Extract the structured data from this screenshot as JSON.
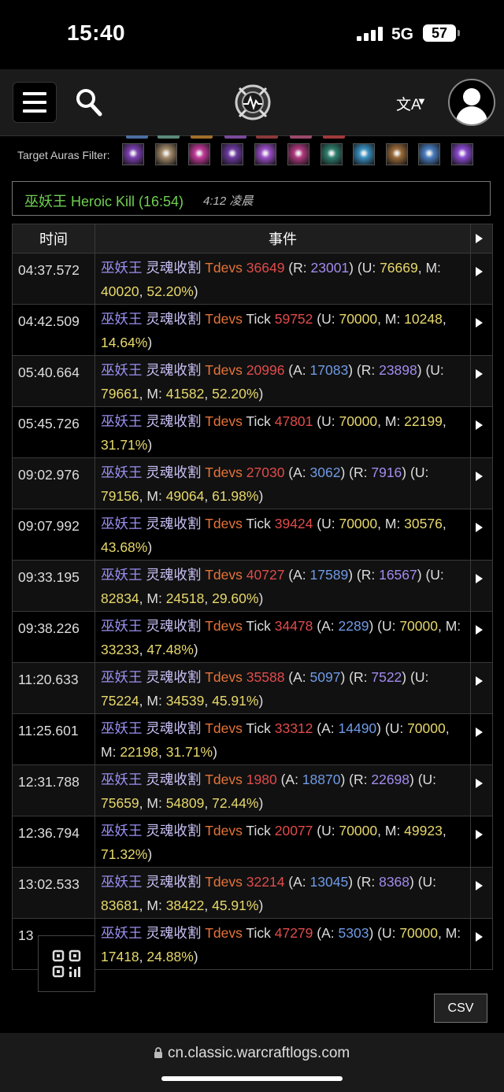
{
  "status_bar": {
    "time": "15:40",
    "network": "5G",
    "battery": "57"
  },
  "header": {
    "menu_icon": "hamburger-icon",
    "search_icon": "search-icon",
    "logo_icon": "warcraftlogs-logo-icon",
    "translate_icon": "translate-icon",
    "avatar_icon": "user-avatar-icon"
  },
  "auras": {
    "label": "Target Auras Filter:",
    "icons": [
      {
        "name": "aura-icon-1",
        "color": "#7b3fb0"
      },
      {
        "name": "aura-icon-2",
        "color": "#a38a6a"
      },
      {
        "name": "aura-icon-3",
        "color": "#c23a9a"
      },
      {
        "name": "aura-icon-4",
        "color": "#6c3aa0"
      },
      {
        "name": "aura-icon-5",
        "color": "#9a4ec7"
      },
      {
        "name": "aura-icon-6",
        "color": "#b03a80"
      },
      {
        "name": "aura-icon-7",
        "color": "#2f7e6e"
      },
      {
        "name": "aura-icon-8",
        "color": "#3a8fc0"
      },
      {
        "name": "aura-icon-9",
        "color": "#9a6a3a"
      },
      {
        "name": "aura-icon-10",
        "color": "#4a7ec0"
      },
      {
        "name": "aura-icon-11",
        "color": "#8a4ad0"
      }
    ]
  },
  "fight": {
    "name": "巫妖王 Heroic Kill (16:54)",
    "time": "4:12 凌晨"
  },
  "table": {
    "headers": {
      "time": "时间",
      "event": "事件"
    },
    "rows": [
      {
        "time": "04:37.572",
        "parts": [
          [
            "巫妖王",
            "src"
          ],
          [
            " 灵魂收割 ",
            "ab"
          ],
          [
            "Tdevs",
            "tgt"
          ],
          [
            " ",
            "g"
          ],
          [
            "36649",
            "dmg"
          ],
          [
            " (R: ",
            "g"
          ],
          [
            "23001",
            "r"
          ],
          [
            ") (U: ",
            "g"
          ],
          [
            "76669",
            "y"
          ],
          [
            ", M: ",
            "g"
          ],
          [
            "40020",
            "y"
          ],
          [
            ", ",
            "g"
          ],
          [
            "52.20%",
            "y"
          ],
          [
            ")",
            "g"
          ]
        ]
      },
      {
        "time": "04:42.509",
        "parts": [
          [
            "巫妖王",
            "src"
          ],
          [
            " 灵魂收割 ",
            "ab"
          ],
          [
            "Tdevs",
            "tgt"
          ],
          [
            " Tick ",
            "g"
          ],
          [
            "59752",
            "dmg"
          ],
          [
            " (U: ",
            "g"
          ],
          [
            "70000",
            "y"
          ],
          [
            ", M: ",
            "g"
          ],
          [
            "10248",
            "y"
          ],
          [
            ", ",
            "g"
          ],
          [
            "14.64%",
            "y"
          ],
          [
            ")",
            "g"
          ]
        ]
      },
      {
        "time": "05:40.664",
        "parts": [
          [
            "巫妖王",
            "src"
          ],
          [
            " 灵魂收割 ",
            "ab"
          ],
          [
            "Tdevs",
            "tgt"
          ],
          [
            " ",
            "g"
          ],
          [
            "20996",
            "dmg"
          ],
          [
            " (A: ",
            "g"
          ],
          [
            "17083",
            "a"
          ],
          [
            ") (R: ",
            "g"
          ],
          [
            "23898",
            "r"
          ],
          [
            ") (U: ",
            "g"
          ],
          [
            "79661",
            "y"
          ],
          [
            ", M: ",
            "g"
          ],
          [
            "41582",
            "y"
          ],
          [
            ", ",
            "g"
          ],
          [
            "52.20%",
            "y"
          ],
          [
            ")",
            "g"
          ]
        ]
      },
      {
        "time": "05:45.726",
        "parts": [
          [
            "巫妖王",
            "src"
          ],
          [
            " 灵魂收割 ",
            "ab"
          ],
          [
            "Tdevs",
            "tgt"
          ],
          [
            " Tick ",
            "g"
          ],
          [
            "47801",
            "dmg"
          ],
          [
            " (U: ",
            "g"
          ],
          [
            "70000",
            "y"
          ],
          [
            ", M: ",
            "g"
          ],
          [
            "22199",
            "y"
          ],
          [
            ", ",
            "g"
          ],
          [
            "31.71%",
            "y"
          ],
          [
            ")",
            "g"
          ]
        ]
      },
      {
        "time": "09:02.976",
        "parts": [
          [
            "巫妖王",
            "src"
          ],
          [
            " 灵魂收割 ",
            "ab"
          ],
          [
            "Tdevs",
            "tgt"
          ],
          [
            " ",
            "g"
          ],
          [
            "27030",
            "dmg"
          ],
          [
            " (A: ",
            "g"
          ],
          [
            "3062",
            "a"
          ],
          [
            ") (R: ",
            "g"
          ],
          [
            "7916",
            "r"
          ],
          [
            ") (U: ",
            "g"
          ],
          [
            "79156",
            "y"
          ],
          [
            ", M: ",
            "g"
          ],
          [
            "49064",
            "y"
          ],
          [
            ", ",
            "g"
          ],
          [
            "61.98%",
            "y"
          ],
          [
            ")",
            "g"
          ]
        ]
      },
      {
        "time": "09:07.992",
        "parts": [
          [
            "巫妖王",
            "src"
          ],
          [
            " 灵魂收割 ",
            "ab"
          ],
          [
            "Tdevs",
            "tgt"
          ],
          [
            " Tick ",
            "g"
          ],
          [
            "39424",
            "dmg"
          ],
          [
            " (U: ",
            "g"
          ],
          [
            "70000",
            "y"
          ],
          [
            ", M: ",
            "g"
          ],
          [
            "30576",
            "y"
          ],
          [
            ", ",
            "g"
          ],
          [
            "43.68%",
            "y"
          ],
          [
            ")",
            "g"
          ]
        ]
      },
      {
        "time": "09:33.195",
        "parts": [
          [
            "巫妖王",
            "src"
          ],
          [
            " 灵魂收割 ",
            "ab"
          ],
          [
            "Tdevs",
            "tgt"
          ],
          [
            " ",
            "g"
          ],
          [
            "40727",
            "dmg"
          ],
          [
            " (A: ",
            "g"
          ],
          [
            "17589",
            "a"
          ],
          [
            ") (R: ",
            "g"
          ],
          [
            "16567",
            "r"
          ],
          [
            ") (U: ",
            "g"
          ],
          [
            "82834",
            "y"
          ],
          [
            ", M: ",
            "g"
          ],
          [
            "24518",
            "y"
          ],
          [
            ", ",
            "g"
          ],
          [
            "29.60%",
            "y"
          ],
          [
            ")",
            "g"
          ]
        ]
      },
      {
        "time": "09:38.226",
        "parts": [
          [
            "巫妖王",
            "src"
          ],
          [
            " 灵魂收割 ",
            "ab"
          ],
          [
            "Tdevs",
            "tgt"
          ],
          [
            " Tick ",
            "g"
          ],
          [
            "34478",
            "dmg"
          ],
          [
            " (A: ",
            "g"
          ],
          [
            "2289",
            "a"
          ],
          [
            ") (U: ",
            "g"
          ],
          [
            "70000",
            "y"
          ],
          [
            ", M: ",
            "g"
          ],
          [
            "33233",
            "y"
          ],
          [
            ", ",
            "g"
          ],
          [
            "47.48%",
            "y"
          ],
          [
            ")",
            "g"
          ]
        ]
      },
      {
        "time": "11:20.633",
        "parts": [
          [
            "巫妖王",
            "src"
          ],
          [
            " 灵魂收割 ",
            "ab"
          ],
          [
            "Tdevs",
            "tgt"
          ],
          [
            " ",
            "g"
          ],
          [
            "35588",
            "dmg"
          ],
          [
            " (A: ",
            "g"
          ],
          [
            "5097",
            "a"
          ],
          [
            ") (R: ",
            "g"
          ],
          [
            "7522",
            "r"
          ],
          [
            ") (U: ",
            "g"
          ],
          [
            "75224",
            "y"
          ],
          [
            ", M: ",
            "g"
          ],
          [
            "34539",
            "y"
          ],
          [
            ", ",
            "g"
          ],
          [
            "45.91%",
            "y"
          ],
          [
            ")",
            "g"
          ]
        ]
      },
      {
        "time": "11:25.601",
        "parts": [
          [
            "巫妖王",
            "src"
          ],
          [
            " 灵魂收割 ",
            "ab"
          ],
          [
            "Tdevs",
            "tgt"
          ],
          [
            " Tick ",
            "g"
          ],
          [
            "33312",
            "dmg"
          ],
          [
            " (A: ",
            "g"
          ],
          [
            "14490",
            "a"
          ],
          [
            ") (U: ",
            "g"
          ],
          [
            "70000",
            "y"
          ],
          [
            ", M: ",
            "g"
          ],
          [
            "22198",
            "y"
          ],
          [
            ", ",
            "g"
          ],
          [
            "31.71%",
            "y"
          ],
          [
            ")",
            "g"
          ]
        ]
      },
      {
        "time": "12:31.788",
        "parts": [
          [
            "巫妖王",
            "src"
          ],
          [
            " 灵魂收割 ",
            "ab"
          ],
          [
            "Tdevs",
            "tgt"
          ],
          [
            " ",
            "g"
          ],
          [
            "1980",
            "dmg"
          ],
          [
            " (A: ",
            "g"
          ],
          [
            "18870",
            "a"
          ],
          [
            ") (R: ",
            "g"
          ],
          [
            "22698",
            "r"
          ],
          [
            ") (U: ",
            "g"
          ],
          [
            "75659",
            "y"
          ],
          [
            ", M: ",
            "g"
          ],
          [
            "54809",
            "y"
          ],
          [
            ", ",
            "g"
          ],
          [
            "72.44%",
            "y"
          ],
          [
            ")",
            "g"
          ]
        ]
      },
      {
        "time": "12:36.794",
        "parts": [
          [
            "巫妖王",
            "src"
          ],
          [
            " 灵魂收割 ",
            "ab"
          ],
          [
            "Tdevs",
            "tgt"
          ],
          [
            " Tick ",
            "g"
          ],
          [
            "20077",
            "dmg"
          ],
          [
            " (U: ",
            "g"
          ],
          [
            "70000",
            "y"
          ],
          [
            ", M: ",
            "g"
          ],
          [
            "49923",
            "y"
          ],
          [
            ", ",
            "g"
          ],
          [
            "71.32%",
            "y"
          ],
          [
            ")",
            "g"
          ]
        ]
      },
      {
        "time": "13:02.533",
        "parts": [
          [
            "巫妖王",
            "src"
          ],
          [
            " 灵魂收割 ",
            "ab"
          ],
          [
            "Tdevs",
            "tgt"
          ],
          [
            " ",
            "g"
          ],
          [
            "32214",
            "dmg"
          ],
          [
            " (A: ",
            "g"
          ],
          [
            "13045",
            "a"
          ],
          [
            ") (R: ",
            "g"
          ],
          [
            "8368",
            "r"
          ],
          [
            ") (U: ",
            "g"
          ],
          [
            "83681",
            "y"
          ],
          [
            ", M: ",
            "g"
          ],
          [
            "38422",
            "y"
          ],
          [
            ", ",
            "g"
          ],
          [
            "45.91%",
            "y"
          ],
          [
            ")",
            "g"
          ]
        ]
      },
      {
        "time": "13",
        "parts": [
          [
            "巫妖王",
            "src"
          ],
          [
            " 灵魂收割 ",
            "ab"
          ],
          [
            "Tdevs",
            "tgt"
          ],
          [
            " Tick ",
            "g"
          ],
          [
            "47279",
            "dmg"
          ],
          [
            " (A: ",
            "g"
          ],
          [
            "5303",
            "a"
          ],
          [
            ") (U: ",
            "g"
          ],
          [
            "70000",
            "y"
          ],
          [
            ", M: ",
            "g"
          ],
          [
            "17418",
            "y"
          ],
          [
            ", ",
            "g"
          ],
          [
            "24.88%",
            "y"
          ],
          [
            ")",
            "g"
          ]
        ]
      }
    ]
  },
  "qr_button_icon": "qr-code-icon",
  "csv_label": "CSV",
  "url_bar": {
    "lock_icon": "lock-icon",
    "url": "cn.classic.warcraftlogs.com"
  }
}
